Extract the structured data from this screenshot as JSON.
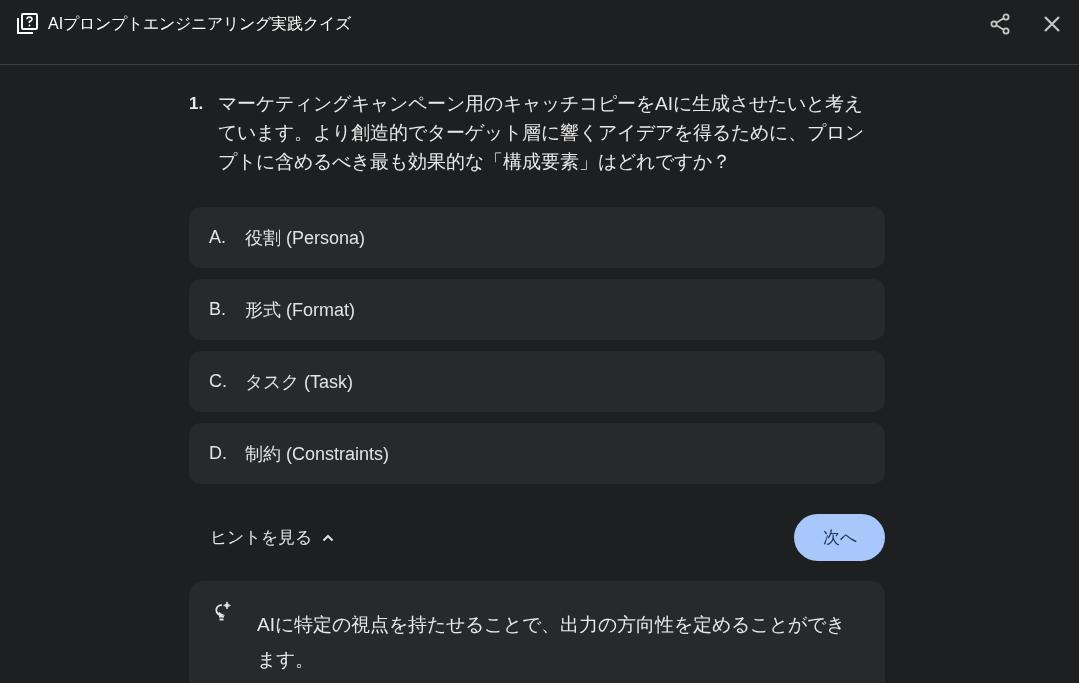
{
  "header": {
    "title": "AIプロンプトエンジニアリング実践クイズ"
  },
  "question": {
    "number": "1.",
    "text": "マーケティングキャンペーン用のキャッチコピーをAIに生成させたいと考えています。より創造的でターゲット層に響くアイデアを得るために、プロンプトに含めるべき最も効果的な「構成要素」はどれですか？"
  },
  "options": [
    {
      "letter": "A.",
      "text": "役割 (Persona)",
      "selected": false
    },
    {
      "letter": "B.",
      "text": "形式 (Format)",
      "selected": false
    },
    {
      "letter": "C.",
      "text": "タスク (Task)",
      "selected": false
    },
    {
      "letter": "D.",
      "text": "制約 (Constraints)",
      "selected": false
    }
  ],
  "hint_toggle": {
    "label": "ヒントを見る",
    "expanded": true
  },
  "next_button": {
    "label": "次へ"
  },
  "hint": {
    "text": "AIに特定の視点を持たせることで、出力の方向性を定めることができます。"
  }
}
